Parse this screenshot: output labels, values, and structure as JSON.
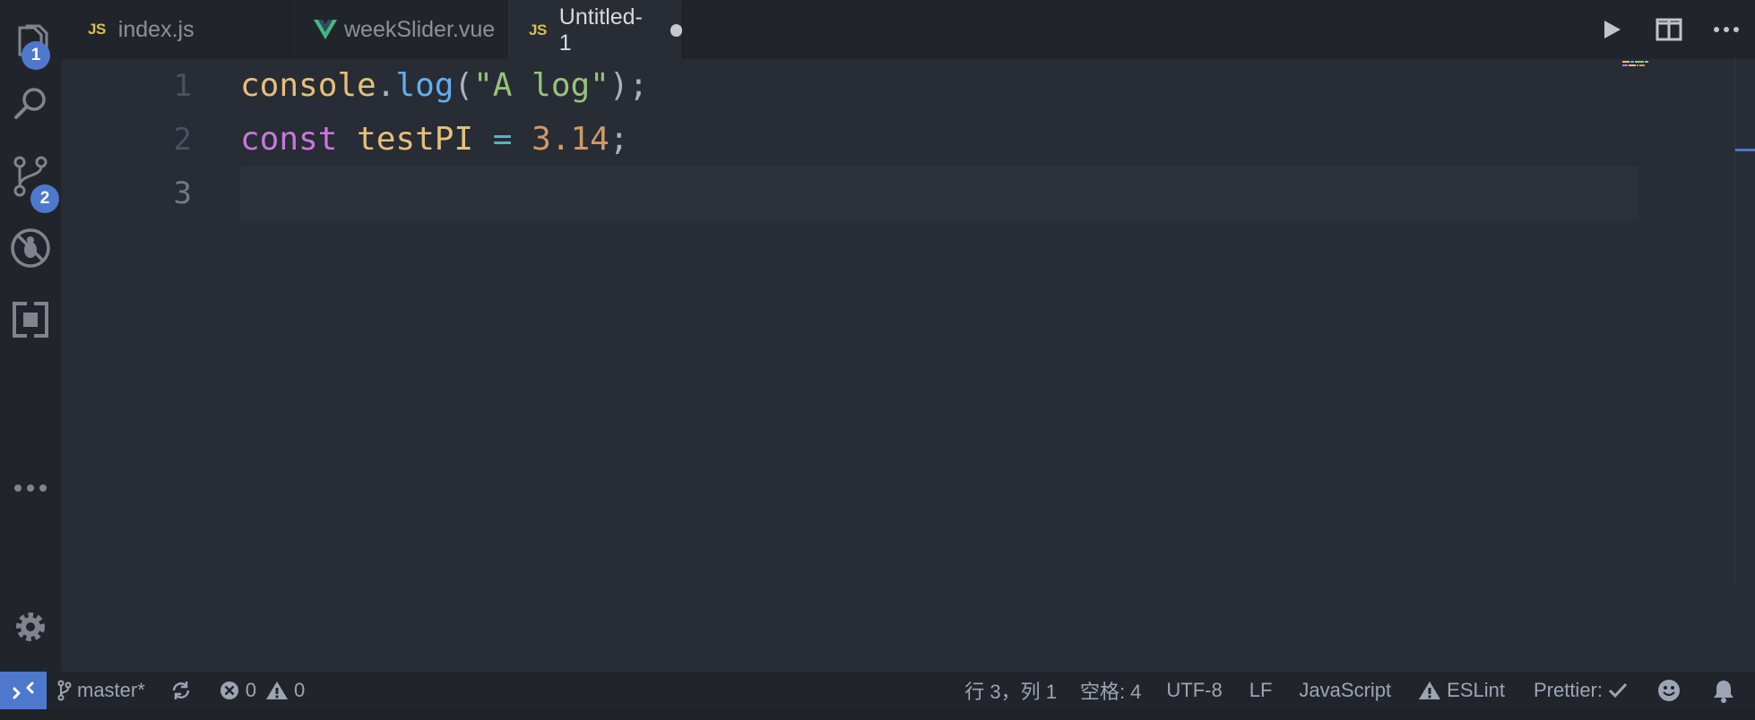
{
  "activity_bar": {
    "explorer_badge": "1",
    "scm_badge": "2"
  },
  "tabs": [
    {
      "lang": "JS",
      "name": "index.js",
      "icon": "js-icon"
    },
    {
      "lang": "",
      "name": "weekSlider.vue",
      "icon": "vue-icon"
    },
    {
      "lang": "JS",
      "name": "Untitled-1",
      "icon": "js-icon",
      "active": true,
      "dirty": true
    }
  ],
  "editor": {
    "lines": [
      {
        "number": "1",
        "tokens": [
          "console",
          ".",
          "log",
          "(",
          "\"A log\"",
          ");"
        ]
      },
      {
        "number": "2",
        "tokens": [
          "const",
          " testPI",
          " ",
          "=",
          " ",
          "3.14",
          ";"
        ]
      },
      {
        "number": "3",
        "tokens": []
      }
    ]
  },
  "status": {
    "branch": "master*",
    "errors": "0",
    "warnings": "0",
    "cursor": "行 3，列 1",
    "indent": "空格: 4",
    "encoding": "UTF-8",
    "eol": "LF",
    "language": "JavaScript",
    "eslint": "ESLint",
    "prettier": "Prettier:"
  },
  "colors": {
    "accent": "#4d78cc",
    "background": "#282c34",
    "sidebar": "#21252b"
  }
}
